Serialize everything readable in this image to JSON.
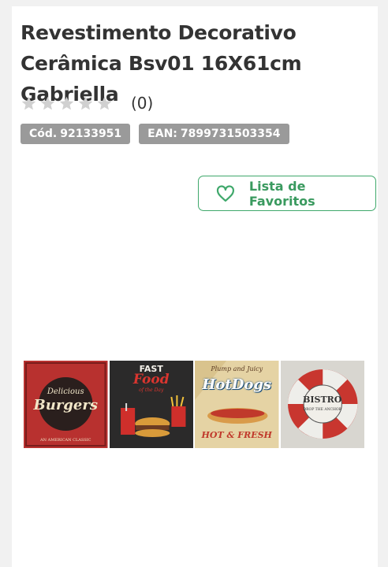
{
  "product": {
    "title": "Revestimento Decorativo Cerâmica Bsv01 16X61cm Gabriella",
    "rating": {
      "stars_filled": 0,
      "stars_total": 5,
      "count": "(0)"
    },
    "codes": {
      "cod_label": "Cód.",
      "cod_value": "92133951",
      "ean_label": "EAN:",
      "ean_value": "7899731503354"
    }
  },
  "actions": {
    "favorites_label": "Lista de Favoritos",
    "favorites_icon": "heart-outline-icon"
  },
  "image": {
    "tiles": [
      {
        "line1": "Delicious",
        "line2": "Burgers",
        "line3": "AN AMERICAN CLASSIC"
      },
      {
        "line1": "FAST",
        "line2": "Food",
        "line3": "of the Day"
      },
      {
        "line1": "Plump and Juicy",
        "line2": "HotDogs",
        "line3": "HOT & FRESH"
      },
      {
        "line1": "BISTRO",
        "line2": "DROP THE ANCHOR"
      }
    ]
  },
  "colors": {
    "accent": "#3fa86b",
    "badge_bg": "#9a9a9a",
    "star": "#d0d0d0"
  }
}
